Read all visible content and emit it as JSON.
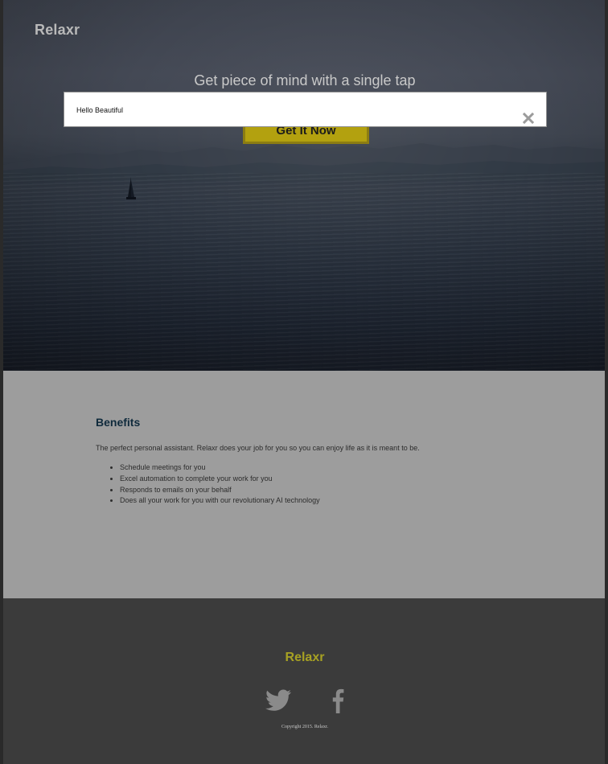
{
  "header": {
    "brand": "Relaxr"
  },
  "hero": {
    "title": "Get piece of mind with a single tap",
    "cta_label": "Get It Now"
  },
  "modal": {
    "message": "Hello Beautiful",
    "close_icon": "close-icon"
  },
  "benefits": {
    "heading": "Benefits",
    "intro": "The perfect personal assistant. Relaxr does your job for you so you can enjoy life as it is meant to be.",
    "items": [
      "Schedule meetings for you",
      "Excel automation to complete your work for you",
      "Responds to emails on your behalf",
      "Does all your work for you with our revolutionary AI technology"
    ]
  },
  "footer": {
    "brand": "Relaxr",
    "social_icons": [
      "twitter-icon",
      "facebook-icon"
    ],
    "copyright": "Copyright 2015. Relaxr."
  },
  "colors": {
    "accent_yellow": "#b3a10f",
    "footer_brand": "#a7a123",
    "benefits_bg": "#9d9d9d",
    "footer_bg": "#3b3b3b",
    "heading_navy": "#0f2a3c"
  }
}
